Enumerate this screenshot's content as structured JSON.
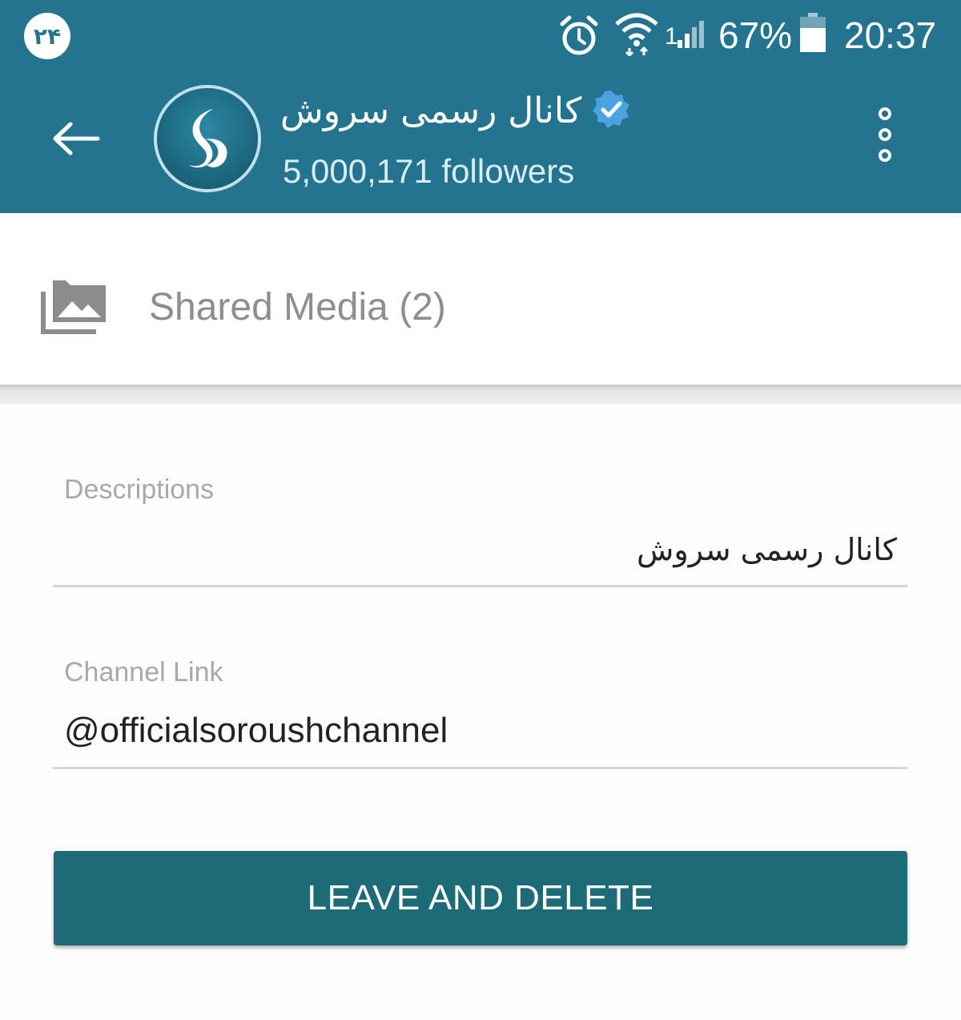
{
  "status_bar": {
    "notification_count": "۲۴",
    "battery_percent": "67%",
    "time": "20:37",
    "signal_sim": "1",
    "icons": [
      "alarm-icon",
      "wifi-icon",
      "cell-signal-icon",
      "battery-icon"
    ]
  },
  "header": {
    "channel_name": "کانال رسمی سروش",
    "followers": "5,000,171 followers",
    "verified": true,
    "icons": [
      "back-arrow-icon",
      "soroush-logo-icon",
      "verified-badge-icon",
      "more-vert-icon"
    ]
  },
  "shared_media": {
    "label": "Shared Media (2)",
    "icon": "photo-library-icon"
  },
  "descriptions": {
    "label": "Descriptions",
    "value": "کانال رسمی سروش"
  },
  "channel_link": {
    "label": "Channel Link",
    "value": "@officialsoroushchannel"
  },
  "leave_button": {
    "label": "LEAVE AND DELETE"
  },
  "colors": {
    "header_bg": "#24738f",
    "button_bg": "#1e6b78",
    "verified_blue": "#4aa3e0"
  }
}
